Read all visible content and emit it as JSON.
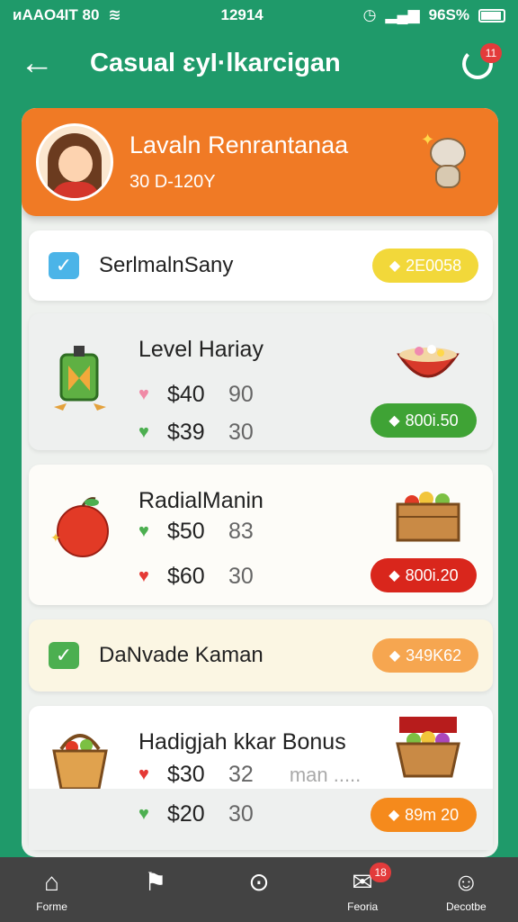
{
  "status_bar": {
    "left_text": "ᴎAAO4IT 80",
    "time": "12914",
    "battery": "96S%"
  },
  "header": {
    "title": "Casual ɛyI·lkarcigan",
    "badge": "11"
  },
  "profile": {
    "name": "Lavaln Renrantanaa",
    "subtitle": "30 D-120Y"
  },
  "simple_rows": [
    {
      "title": "SerlmalnSany",
      "pill": "2E0058"
    },
    {
      "title": "DaNvade Kaman",
      "pill": "349K62"
    }
  ],
  "offers": [
    {
      "title": "Level Hariay",
      "lines": [
        {
          "price": "$40",
          "qty": "90"
        },
        {
          "price": "$39",
          "qty": "30"
        }
      ],
      "pill": "800i.50"
    },
    {
      "title": "RadialManin",
      "lines": [
        {
          "price": "$50",
          "qty": "83"
        },
        {
          "price": "$60",
          "qty": "30"
        }
      ],
      "pill": "800i.20"
    },
    {
      "title": "Hadigjah kkar Bonus",
      "lines": [
        {
          "price": "$30",
          "qty": "32",
          "extra": "man ....."
        },
        {
          "price": "$20",
          "qty": "30"
        }
      ],
      "pill": "89m 20"
    }
  ],
  "bottom_nav": [
    {
      "label": "Forme",
      "icon": "home-icon"
    },
    {
      "label": "",
      "icon": "flag-icon"
    },
    {
      "label": "",
      "icon": "chevron-circle-icon"
    },
    {
      "label": "Feoria",
      "icon": "chat-icon",
      "badge": "18"
    },
    {
      "label": "Decotbe",
      "icon": "profile-icon"
    }
  ],
  "colors": {
    "background": "#1f9a6a",
    "profile_card": "#f07a25",
    "nav_bar": "#434343"
  }
}
